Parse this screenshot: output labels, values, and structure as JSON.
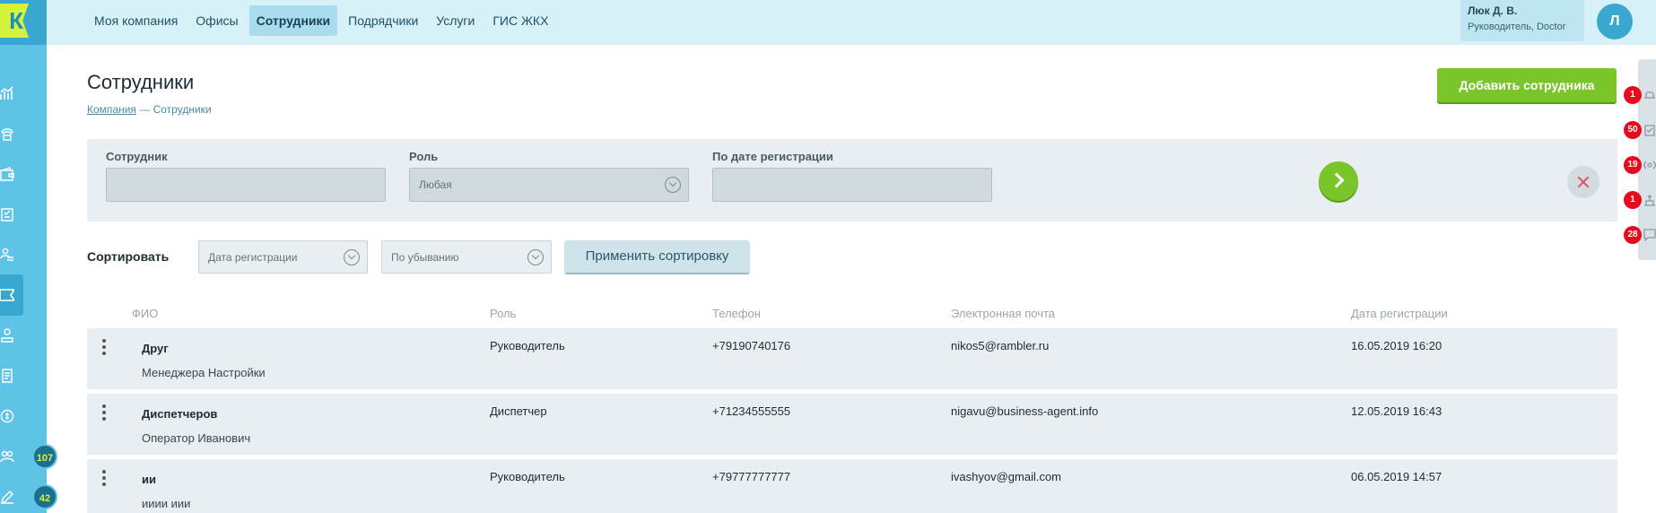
{
  "app": {
    "logo_letter": "К"
  },
  "nav": {
    "items": [
      {
        "label": "Моя компания",
        "active": false
      },
      {
        "label": "Офисы",
        "active": false
      },
      {
        "label": "Сотрудники",
        "active": true
      },
      {
        "label": "Подрядчики",
        "active": false
      },
      {
        "label": "Услуги",
        "active": false
      },
      {
        "label": "ГИС ЖКХ",
        "active": false
      }
    ]
  },
  "user": {
    "name": "Люк Д. В.",
    "role": "Руководитель, Doctor",
    "avatar_letter": "Л"
  },
  "sidebar": {
    "badges": [
      "107",
      "42"
    ]
  },
  "notifications": {
    "counts": [
      "1",
      "50",
      "19",
      "1",
      "28"
    ]
  },
  "header": {
    "title": "Сотрудники",
    "breadcrumb_link": "Компания",
    "breadcrumb_separator": "—",
    "breadcrumb_current": "Сотрудники",
    "add_button": "Добавить сотрудника"
  },
  "filters": {
    "employee_label": "Сотрудник",
    "employee_value": "",
    "role_label": "Роль",
    "role_value": "Любая",
    "date_label": "По дате регистрации",
    "date_value": ""
  },
  "sort": {
    "label": "Сортировать",
    "field_value": "Дата регистрации",
    "order_value": "По убыванию",
    "apply_label": "Применить сортировку"
  },
  "table": {
    "headers": {
      "name": "ФИО",
      "role": "Роль",
      "phone": "Телефон",
      "email": "Электронная почта",
      "registered": "Дата регистрации"
    },
    "rows": [
      {
        "last_name": "Друг",
        "first_name": "Менеджера Настройки",
        "role": "Руководитель",
        "phone": "+79190740176",
        "email": "nikos5@rambler.ru",
        "registered": "16.05.2019 16:20"
      },
      {
        "last_name": "Диспетчеров",
        "first_name": "Оператор Иванович",
        "role": "Диспетчер",
        "phone": "+71234555555",
        "email": "nigavu@business-agent.info",
        "registered": "12.05.2019 16:43"
      },
      {
        "last_name": "ии",
        "first_name": "ииии иии",
        "role": "Руководитель",
        "phone": "+79777777777",
        "email": "ivashyov@gmail.com",
        "registered": "06.05.2019 14:57"
      }
    ]
  },
  "colors": {
    "sidebar": "#5ec3e6",
    "topbar": "#d6f1f7",
    "accent_green": "#7ac62a",
    "badge_red": "#e80a1c",
    "panel": "#e8eef1"
  }
}
